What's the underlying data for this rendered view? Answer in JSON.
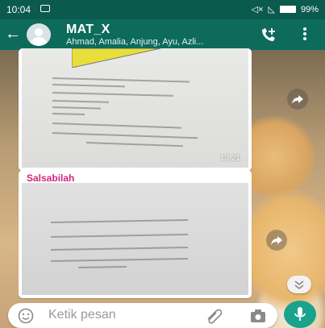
{
  "status_bar": {
    "time": "10:04",
    "battery_percent": "99%"
  },
  "chat": {
    "title": "MAT_X",
    "members": "Ahmad, Amalia, Anjung, Ayu, Azli..."
  },
  "messages": [
    {
      "sender": "",
      "time": "13.21"
    },
    {
      "sender": "Salsabilah",
      "time": ""
    }
  ],
  "composer": {
    "placeholder": "Ketik pesan"
  },
  "colors": {
    "header": "#0d6b5c",
    "statusbar": "#0a5a4d",
    "accent": "#1aa38c",
    "sender_name": "#d1267c"
  }
}
